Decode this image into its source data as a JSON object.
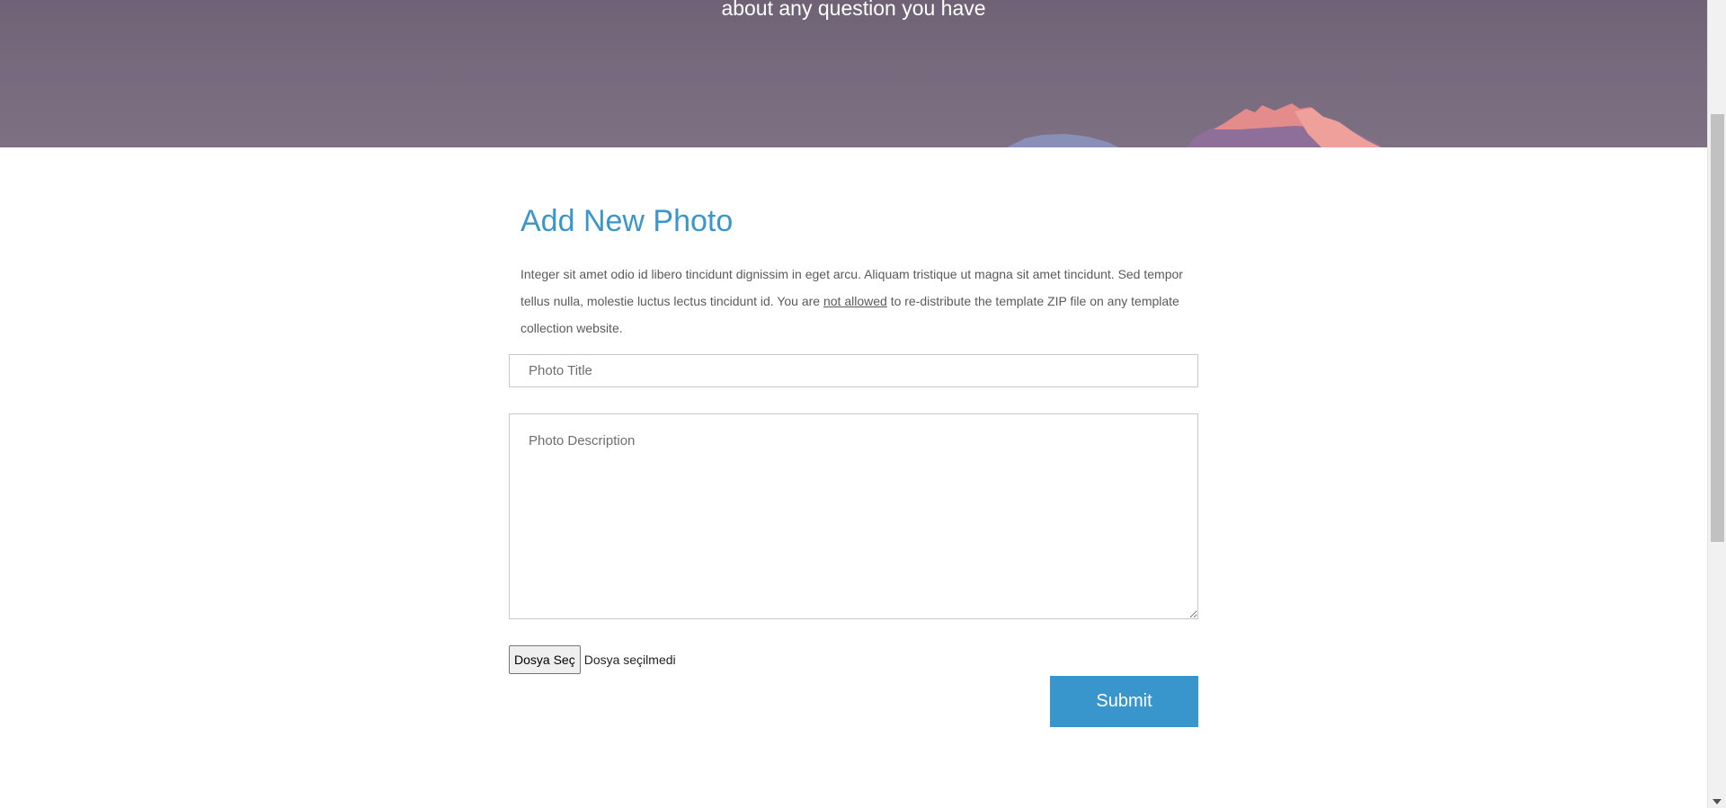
{
  "hero": {
    "subtitle": "about any question you have"
  },
  "form": {
    "title": "Add New Photo",
    "description_part1": "Integer sit amet odio id libero tincidunt dignissim in eget arcu. Aliquam tristique ut magna sit amet tincidunt. Sed tempor tellus nulla, molestie luctus lectus tincidunt id. You are ",
    "description_link": "not allowed",
    "description_part2": " to re-distribute the template ZIP file on any template collection website.",
    "title_placeholder": "Photo Title",
    "description_placeholder": "Photo Description",
    "file_button_label": "Dosya Seç",
    "file_status": "Dosya seçilmedi",
    "submit_label": "Submit"
  },
  "colors": {
    "accent": "#3996cc",
    "hero_bg": "#776a7d"
  }
}
